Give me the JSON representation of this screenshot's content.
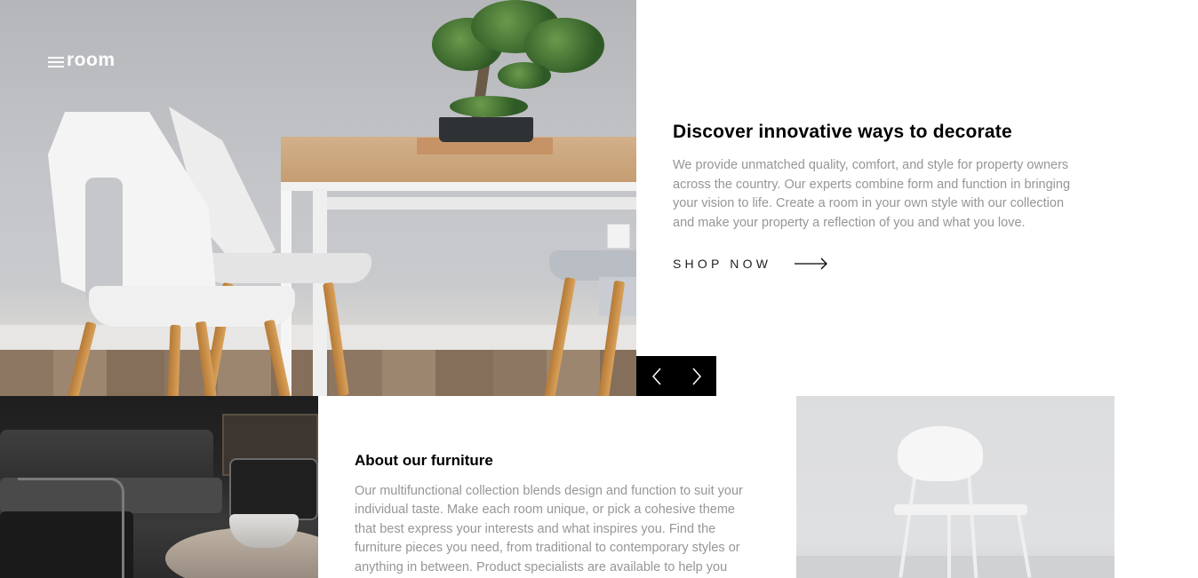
{
  "brand": {
    "name": "room",
    "menu_icon": "hamburger-icon"
  },
  "hero": {
    "title": "Discover innovative ways to decorate",
    "description": "We provide unmatched quality, comfort, and style for property owners across the country. Our experts combine form and function in bringing your vision to life. Create a room in your own style with our collection and make your property a reflection of you and what you love.",
    "cta_label": "SHOP NOW",
    "cta_icon": "arrow-right-icon"
  },
  "slider": {
    "prev_icon": "chevron-left-icon",
    "next_icon": "chevron-right-icon"
  },
  "about": {
    "title": "About our furniture",
    "description": "Our multifunctional collection blends design and function to suit your individual taste. Make each room unique, or pick a cohesive theme that best express your interests and what inspires you. Find the furniture pieces you need, from traditional to contemporary styles or anything in between. Product specialists are available to help you create your"
  },
  "colors": {
    "text_primary": "#000000",
    "text_muted": "#969696",
    "nav_bg": "#000000",
    "background": "#ffffff"
  }
}
